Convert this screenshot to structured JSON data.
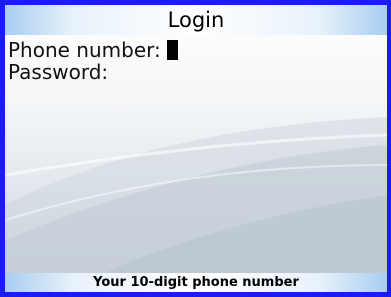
{
  "header": {
    "title": "Login"
  },
  "form": {
    "phone_label": "Phone number:",
    "phone_value": "",
    "password_label": "Password:",
    "password_value": ""
  },
  "status": {
    "hint": "Your 10-digit phone number"
  },
  "colors": {
    "frame": "#1c1cf0",
    "bar_light": "#ffffff",
    "bar_accent": "#a8cdef",
    "text": "#000000"
  }
}
